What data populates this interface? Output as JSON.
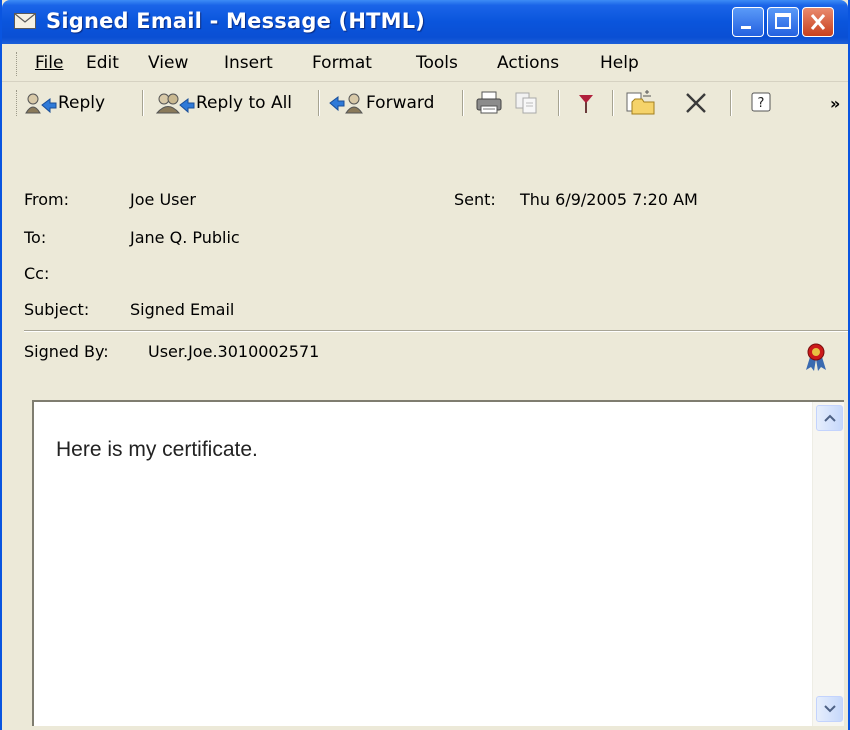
{
  "window": {
    "title": "Signed Email - Message (HTML)"
  },
  "menu": [
    "File",
    "Edit",
    "View",
    "Insert",
    "Format",
    "Tools",
    "Actions",
    "Help"
  ],
  "toolbar": {
    "reply": "Reply",
    "reply_all": "Reply to All",
    "forward": "Forward",
    "overflow": "»"
  },
  "header": {
    "from_label": "From:",
    "from_value": "Joe User",
    "sent_label": "Sent:",
    "sent_value": "Thu 6/9/2005 7:20 AM",
    "to_label": "To:",
    "to_value": "Jane Q. Public",
    "cc_label": "Cc:",
    "cc_value": "",
    "subject_label": "Subject:",
    "subject_value": "Signed Email",
    "signed_label": "Signed By:",
    "signed_value": "User.Joe.3010002571"
  },
  "message": {
    "body": "Here is my certificate."
  },
  "icons": [
    "envelope-icon",
    "reply-icon",
    "reply-all-icon",
    "forward-icon",
    "print-icon",
    "copy-icon",
    "flag-icon",
    "move-folder-icon",
    "delete-icon",
    "help-icon",
    "signature-ribbon-icon"
  ],
  "colors": {
    "titlebar": "#0a55dc",
    "window_bg": "#ece9d8",
    "flag": "#b0203c",
    "ribbon": "#cc1a1a"
  }
}
